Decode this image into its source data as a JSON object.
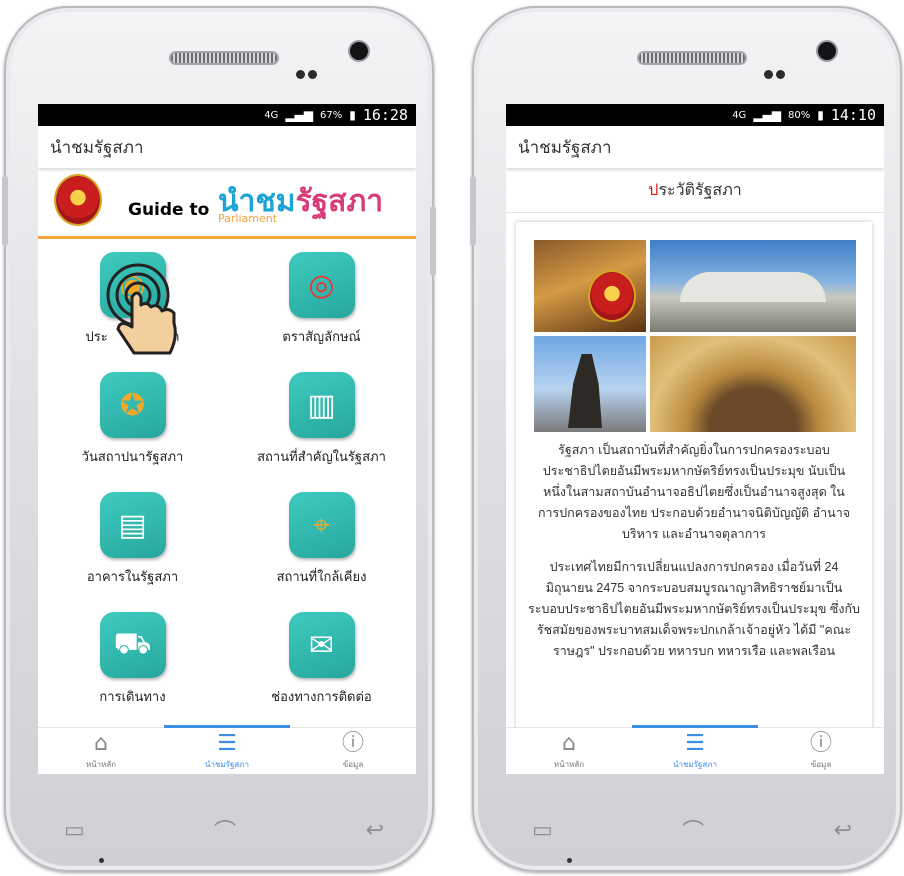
{
  "left_phone": {
    "status": {
      "network": "4G",
      "battery": "67%",
      "time": "16:28"
    },
    "appbar_title": "นำชมรัฐสภา",
    "banner": {
      "guide": "Guide to",
      "title_a": "นำชม",
      "title_b": "รัฐสภา",
      "sub": "Parliament"
    },
    "menu": [
      {
        "label": "ประวัติรัฐสภา",
        "icon": "history-icon"
      },
      {
        "label": "ตราสัญลักษณ์",
        "icon": "emblem-icon"
      },
      {
        "label": "วันสถาปนารัฐสภา",
        "icon": "award-ribbon-icon"
      },
      {
        "label": "สถานที่สำคัญในรัฐสภา",
        "icon": "buildings-icon"
      },
      {
        "label": "อาคารในรัฐสภา",
        "icon": "parliament-building-icon"
      },
      {
        "label": "สถานที่ใกล้เคียง",
        "icon": "map-pin-icon"
      },
      {
        "label": "การเดินทาง",
        "icon": "car-icon"
      },
      {
        "label": "ช่องทางการติดต่อ",
        "icon": "mail-contact-icon"
      }
    ],
    "visible_label_0": "ประ",
    "visible_label_0b": "ภา"
  },
  "right_phone": {
    "status": {
      "network": "4G",
      "battery": "80%",
      "time": "14:10"
    },
    "appbar_title": "นำชมรัฐสภา",
    "subhead_red": "ป",
    "subhead_rest": "ระวัติรัฐสภา",
    "paragraph1": "รัฐสภา เป็นสถาบันที่สำคัญยิ่งในการปกครองระบอบประชาธิปไตยอันมีพระมหากษัตริย์ทรงเป็นประมุข นับเป็นหนึ่งในสามสถาบันอำนาจอธิปไตยซึ่งเป็นอำนาจสูงสุด ในการปกครองของไทย ประกอบด้วยอำนาจนิติบัญญัติ อำนาจบริหาร และอำนาจตุลาการ",
    "paragraph2": "ประเทศไทยมีการเปลี่ยนแปลงการปกครอง เมื่อวันที่ 24 มิถุนายน 2475 จากระบอบสมบูรณาญาสิทธิราชย์มาเป็นระบอบประชาธิปไตยอันมีพระมหากษัตริย์ทรงเป็นประมุข ซึ่งกับรัชสมัยของพระบาทสมเด็จพระปกเกล้าเจ้าอยู่หัว ได้มี \"คณะราษฎร\" ประกอบด้วย ทหารบก ทหารเรือ และพลเรือน"
  },
  "bottom_nav": [
    {
      "label": "หน้าหลัก",
      "icon": "home-icon"
    },
    {
      "label": "นำชมรัฐสภา",
      "icon": "list-icon"
    },
    {
      "label": "ข้อมูล",
      "icon": "info-icon"
    }
  ],
  "colors": {
    "accent": "#3a8ee6",
    "tile": "#2fb8ae",
    "banner_line": "#f2a33a",
    "title_red": "#d32020"
  }
}
